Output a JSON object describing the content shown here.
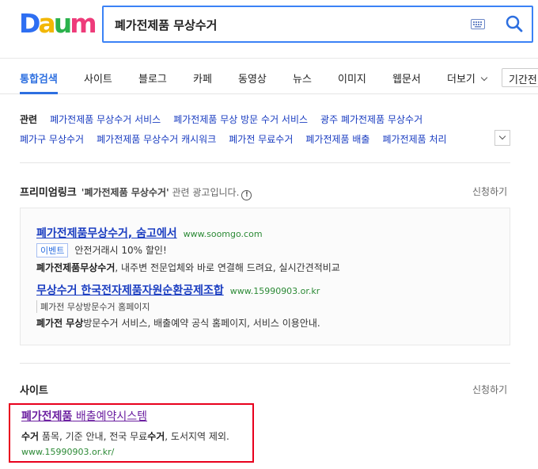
{
  "logo": {
    "letters": [
      "D",
      "a",
      "u",
      "m"
    ],
    "colors": [
      "#2e6ff2",
      "#f2b705",
      "#2bb24c",
      "#ee3b7a"
    ]
  },
  "search": {
    "query": "폐가전제품 무상수거"
  },
  "tabs": [
    {
      "label": "통합검색",
      "active": true
    },
    {
      "label": "사이트"
    },
    {
      "label": "블로그"
    },
    {
      "label": "카페"
    },
    {
      "label": "동영상"
    },
    {
      "label": "뉴스"
    },
    {
      "label": "이미지"
    },
    {
      "label": "웹문서"
    },
    {
      "label": "더보기"
    }
  ],
  "period": "기간전",
  "related": {
    "title": "관련",
    "row1": [
      "폐가전제품 무상수거 서비스",
      "폐가전제품 무상 방문 수거 서비스",
      "광주 폐가전제품 무상수거"
    ],
    "row2": [
      "폐가구 무상수거",
      "폐가전제품 무상수거 캐시워크",
      "폐가전 무료수거",
      "폐가전제품 배출",
      "폐가전제품 처리"
    ]
  },
  "premium": {
    "title": "프리미엄링크",
    "sub_prefix": "'폐가전제품 무상수거'",
    "sub_suffix": " 관련 광고입니다.",
    "info": "!",
    "apply": "신청하기",
    "ads": [
      {
        "title": "폐가전제품무상수거, 숨고에서",
        "url": "www.soomgo.com",
        "badge": "이벤트",
        "badge_text": "안전거래시 10% 할인!",
        "desc_bold": "폐가전제품무상수거",
        "desc_rest": ", 내주변 전문업체와 바로 연결해 드려요, 실시간견적비교"
      },
      {
        "title": "무상수거 한국전자제품자원순환공제조합",
        "url": "www.15990903.or.kr",
        "badge": "",
        "badge_text": "폐가전 무상방문수거 홈페이지",
        "desc_bold": "폐가전 무상",
        "desc_bold2": "방문수거",
        "desc_rest": " 서비스, 배출예약 공식 홈페이지, 서비스 이용안내."
      }
    ]
  },
  "site": {
    "title": "사이트",
    "apply": "신청하기",
    "result": {
      "title_bold": "폐가전제품",
      "title_rest": " 배출예약시스템",
      "desc_b1": "수거",
      "desc_t1": " 품목, 기준 안내, 전국 무료",
      "desc_b2": "수거",
      "desc_t2": ", 도서지역 제외.",
      "url": "www.15990903.or.kr/"
    }
  },
  "colors": {
    "accent": "#2d6fe0",
    "link": "#1a3dc1",
    "visited": "#6b1fa0",
    "url": "#2c8a36",
    "highlight_box": "#e8001d"
  }
}
